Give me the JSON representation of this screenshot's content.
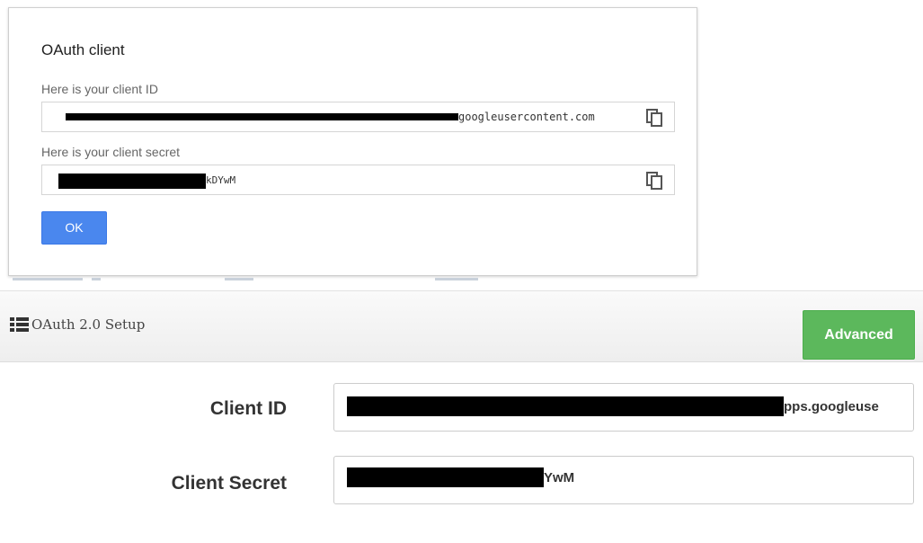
{
  "dialog": {
    "title": "OAuth client",
    "client_id_label": "Here is your client ID",
    "client_id_visible_suffix": "googleusercontent.com",
    "client_secret_label": "Here is your client secret",
    "client_secret_visible_suffix": "kDYwM",
    "ok_label": "OK"
  },
  "setup_panel": {
    "title": "OAuth 2.0 Setup",
    "advanced_label": "Advanced",
    "client_id_label": "Client ID",
    "client_id_visible_suffix": "pps.googleuse",
    "client_secret_label": "Client Secret",
    "client_secret_visible_suffix": "YwM"
  },
  "icons": {
    "copy": "copy-icon",
    "list": "list-icon"
  },
  "colors": {
    "ok_button": "#4a87ee",
    "advanced_button": "#5cb85c",
    "redaction": "#000000"
  }
}
